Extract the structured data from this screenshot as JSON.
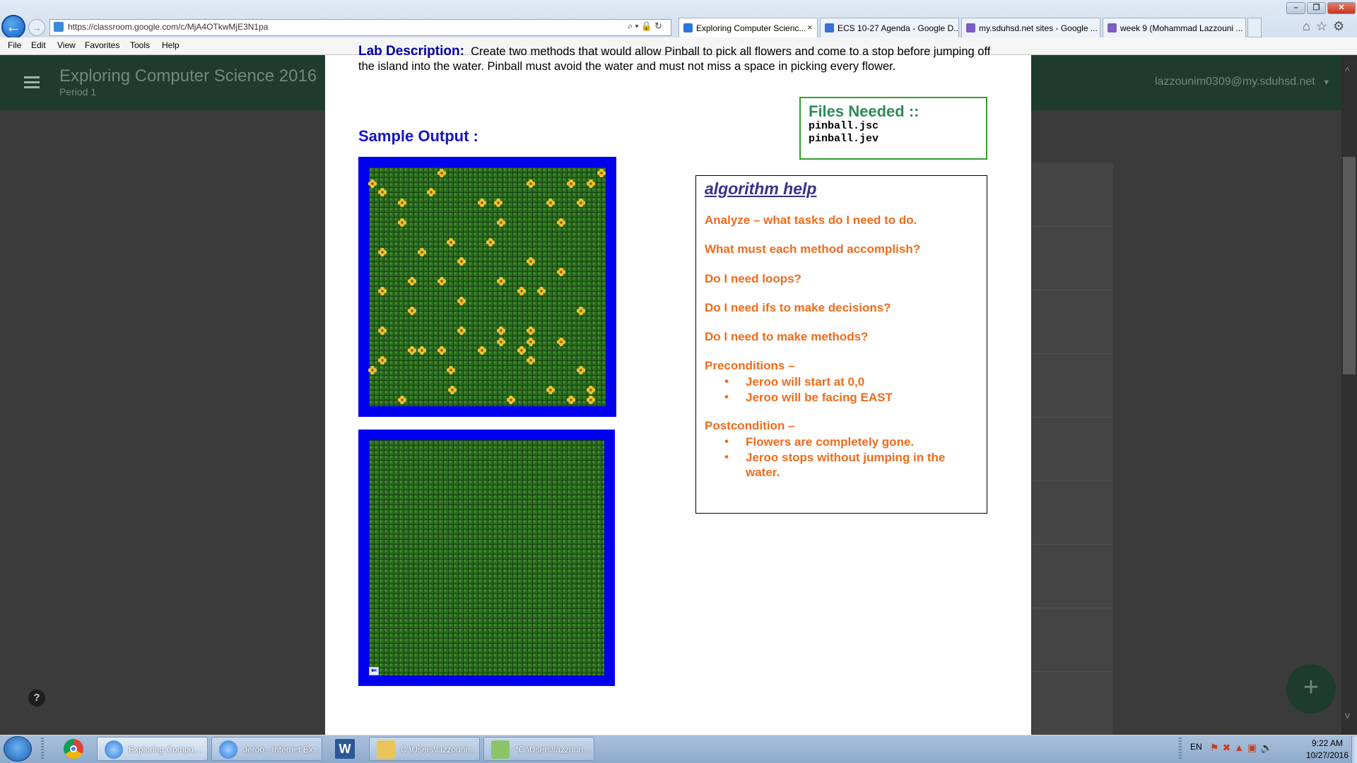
{
  "browser": {
    "url": "https://classroom.google.com/c/MjA4OTkwMjE3N1pa",
    "tabs": [
      {
        "label": "Exploring Computer Scienc...",
        "color": "#2a77d8"
      },
      {
        "label": "ECS 10-27 Agenda - Google D...",
        "color": "#3b6fd6"
      },
      {
        "label": "my.sduhsd.net sites - Google ...",
        "color": "#7b5dc4"
      },
      {
        "label": "week 9 (Mohammad Lazzouni ...",
        "color": "#7b5dc4"
      }
    ],
    "menu": [
      "File",
      "Edit",
      "View",
      "Favorites",
      "Tools",
      "Help"
    ]
  },
  "classroom": {
    "title": "Exploring Computer Science 2016",
    "period": "Period 1",
    "user": "lazzounim0309@my.sduhsd.net"
  },
  "doc": {
    "lab_heading": "Lab Description:",
    "lab_text": "Create two methods that would allow Pinball to pick all flowers and come to a stop before jumping off the island into the water. Pinball must avoid the water and must not miss a space in picking every flower.",
    "files_title": "Files Needed ::",
    "files": [
      "pinball.jsc",
      "pinball.jev"
    ],
    "sample_output": "Sample Output :",
    "algo_title": "algorithm help",
    "algo_lines": [
      "Analyze – what tasks do I need to do.",
      "What must each method accomplish?",
      "Do I need loops?",
      "Do I need ifs to make decisions?",
      "Do I need to make methods?"
    ],
    "preconditions_title": "Preconditions –",
    "preconditions": [
      "Jeroo will start at 0,0",
      "Jeroo will be facing EAST"
    ],
    "postconditions_title": "Postcondition –",
    "postconditions": [
      "Flowers are completely gone.",
      "Jeroo stops without jumping in the water."
    ],
    "bullet": "•"
  },
  "icons": {
    "back": "←",
    "forward": "→",
    "help": "?",
    "add": "+",
    "scroll_up": "^",
    "scroll_down": "v",
    "tab_close": "×",
    "jeroo": "⇐"
  },
  "taskbar": {
    "buttons": [
      "Exploring Compu...",
      "Jeroo - Internet Ex...",
      "C:\\Users\\lazzouni...",
      "*C:\\Users\\lazzoun..."
    ],
    "lang": "EN",
    "time": "9:22 AM",
    "date": "10/27/2016"
  },
  "colors": {
    "water": "#0000ee",
    "grass": "#2a6b1f",
    "flower": "#f2c12e",
    "orange_text": "#f26b1a"
  }
}
